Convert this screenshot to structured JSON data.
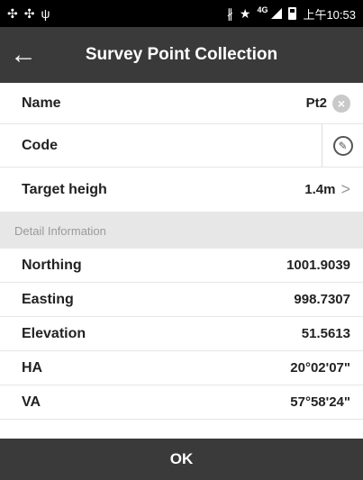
{
  "status_bar": {
    "left_icons": [
      "sync-icon",
      "sync-icon",
      "usb-icon"
    ],
    "network": "4G",
    "time": "上午10:53"
  },
  "header": {
    "title": "Survey Point Collection"
  },
  "form": {
    "name": {
      "label": "Name",
      "value": "Pt2"
    },
    "code": {
      "label": "Code",
      "value": ""
    },
    "target_height": {
      "label": "Target heigh",
      "value": "1.4m"
    }
  },
  "detail": {
    "section_label": "Detail Information",
    "rows": [
      {
        "label": "Northing",
        "value": "1001.9039"
      },
      {
        "label": "Easting",
        "value": "998.7307"
      },
      {
        "label": "Elevation",
        "value": "51.5613"
      },
      {
        "label": "HA",
        "value": "20°02'07\""
      },
      {
        "label": "VA",
        "value": "57°58'24\""
      }
    ]
  },
  "footer": {
    "ok_label": "OK"
  }
}
